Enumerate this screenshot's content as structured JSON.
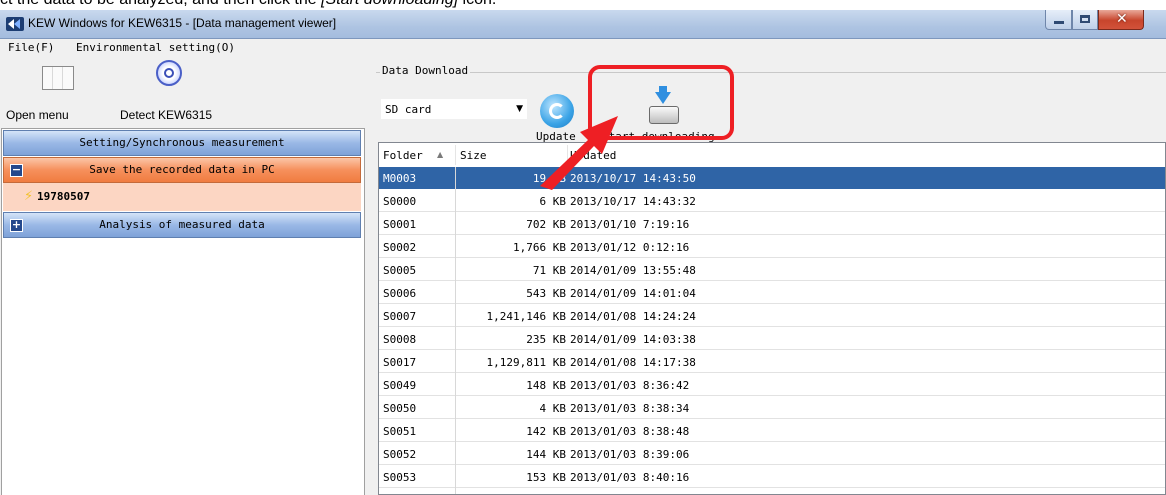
{
  "instruction": {
    "prefix": "ct the data to be analyzed, and then click the ",
    "emphasis": "[Start downloading]",
    "suffix": " icon."
  },
  "window": {
    "title": "KEW Windows for KEW6315 - [Data management viewer]",
    "close_glyph": "✕"
  },
  "menu": [
    {
      "label": "File(F)"
    },
    {
      "label": "Environmental setting(O)"
    }
  ],
  "toolbar": {
    "open_menu": "Open menu",
    "detect": "Detect KEW6315"
  },
  "sidebar": {
    "setting_header": "Setting/Synchronous measurement",
    "save_header": "Save the recorded data in PC",
    "save_toggle": "−",
    "save_subitem": "19780507",
    "bolt_glyph": "⚡",
    "analysis_header": "Analysis of measured data",
    "analysis_toggle": "+"
  },
  "download": {
    "group_label": "Data Download",
    "source": "SD card",
    "dropdown_glyph": "▼",
    "update_label": "Update",
    "start_label": "Start downloading"
  },
  "list": {
    "columns": {
      "folder": "Folder",
      "size": "Size",
      "updated": "Updated"
    },
    "sort_glyph": "▲",
    "rows": [
      {
        "folder": "M0003",
        "size": "19 KB",
        "updated": "2013/10/17 14:43:50"
      },
      {
        "folder": "S0000",
        "size": "6 KB",
        "updated": "2013/10/17 14:43:32"
      },
      {
        "folder": "S0001",
        "size": "702 KB",
        "updated": "2013/01/10 7:19:16"
      },
      {
        "folder": "S0002",
        "size": "1,766 KB",
        "updated": "2013/01/12 0:12:16"
      },
      {
        "folder": "S0005",
        "size": "71 KB",
        "updated": "2014/01/09 13:55:48"
      },
      {
        "folder": "S0006",
        "size": "543 KB",
        "updated": "2014/01/09 14:01:04"
      },
      {
        "folder": "S0007",
        "size": "1,241,146 KB",
        "updated": "2014/01/08 14:24:24"
      },
      {
        "folder": "S0008",
        "size": "235 KB",
        "updated": "2014/01/09 14:03:38"
      },
      {
        "folder": "S0017",
        "size": "1,129,811 KB",
        "updated": "2014/01/08 14:17:38"
      },
      {
        "folder": "S0049",
        "size": "148 KB",
        "updated": "2013/01/03 8:36:42"
      },
      {
        "folder": "S0050",
        "size": "4 KB",
        "updated": "2013/01/03 8:38:34"
      },
      {
        "folder": "S0051",
        "size": "142 KB",
        "updated": "2013/01/03 8:38:48"
      },
      {
        "folder": "S0052",
        "size": "144 KB",
        "updated": "2013/01/03 8:39:06"
      },
      {
        "folder": "S0053",
        "size": "153 KB",
        "updated": "2013/01/03 8:40:16"
      }
    ]
  },
  "colors": {
    "selected_row": "#2f64a6",
    "highlight": "#ee1f24",
    "blue_header": "#9ab8e6",
    "orange_header": "#f6905c",
    "subitem_bg": "#fcd6c3"
  },
  "icons": {
    "app": "kew-app-icon",
    "open_menu": "columns-icon",
    "detect": "detect-target-icon",
    "update": "refresh-icon",
    "download": "download-disk-icon",
    "callout": "red-arrow-icon"
  }
}
